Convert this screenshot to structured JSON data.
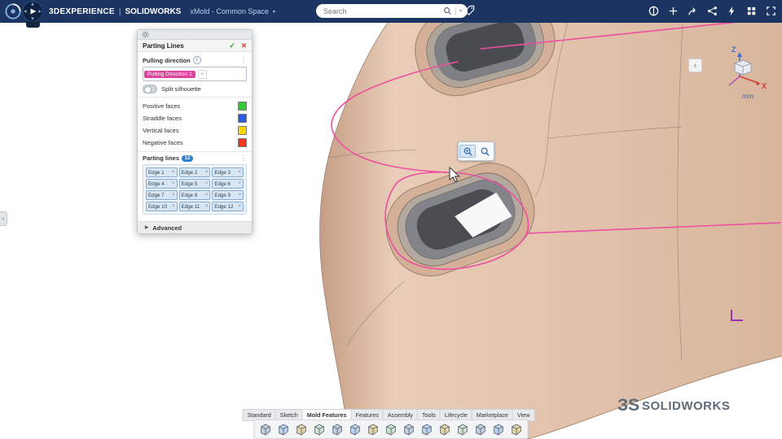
{
  "topbar": {
    "brand": "3DEXPERIENCE",
    "separator": "|",
    "app": "SOLIDWORKS",
    "workspace": "xMold - Common Space",
    "search": {
      "placeholder": "Search"
    },
    "right_icons": [
      "status",
      "add",
      "share",
      "network",
      "lightning",
      "apps",
      "fullscreen"
    ]
  },
  "panel": {
    "title": "Parting Lines",
    "sections": {
      "pulling": {
        "label": "Pulling direction",
        "value": "Pulling Direction 1",
        "split_silhouette": "Split silhouette"
      },
      "faces": [
        {
          "label": "Positive faces",
          "color": "#33cc33"
        },
        {
          "label": "Straddle faces",
          "color": "#2d5be3"
        },
        {
          "label": "Vertical faces",
          "color": "#ffd400"
        },
        {
          "label": "Negative faces",
          "color": "#f2391f"
        }
      ],
      "parting_lines": {
        "label": "Parting lines",
        "count": "12",
        "edges": [
          "Edge 1",
          "Edge 2",
          "Edge 3",
          "Edge 4",
          "Edge 5",
          "Edge 6",
          "Edge 7",
          "Edge 8",
          "Edge 9",
          "Edge 10",
          "Edge 11",
          "Edge 12"
        ]
      },
      "advanced": {
        "label": "Advanced"
      }
    }
  },
  "viewport": {
    "units": "mm",
    "axes": {
      "z": "Z",
      "x": "X"
    }
  },
  "command_bar": {
    "tabs": [
      "Standard",
      "Sketch",
      "Mold Features",
      "Features",
      "Assembly",
      "Tools",
      "Lifecycle",
      "Marketplace",
      "View"
    ],
    "active_tab": "Mold Features",
    "icons": [
      "select",
      "sketch",
      "save",
      "print",
      "settings",
      "rebuild",
      "draft-analysis",
      "undercut-analysis",
      "parting-lines",
      "shut-off-surfaces",
      "parting-surfaces",
      "tooling-split",
      "core",
      "measure",
      "section-view"
    ]
  },
  "branding": {
    "logo_mark": "ЗS",
    "logo_text": "SOLIDWORKS"
  },
  "ui": {
    "ok": "✓",
    "cancel": "✕",
    "close": "×",
    "menu": "⋮",
    "info": "i",
    "expand": "▶",
    "back": "‹",
    "chevron": "▾"
  },
  "colors": {
    "topbar_bg": "#1c3462",
    "selection_magenta": "#e0439b",
    "parting_line_pink": "#ed4fa0",
    "model_tan": "#e2c2ab",
    "badge_blue": "#2f7fd1"
  }
}
